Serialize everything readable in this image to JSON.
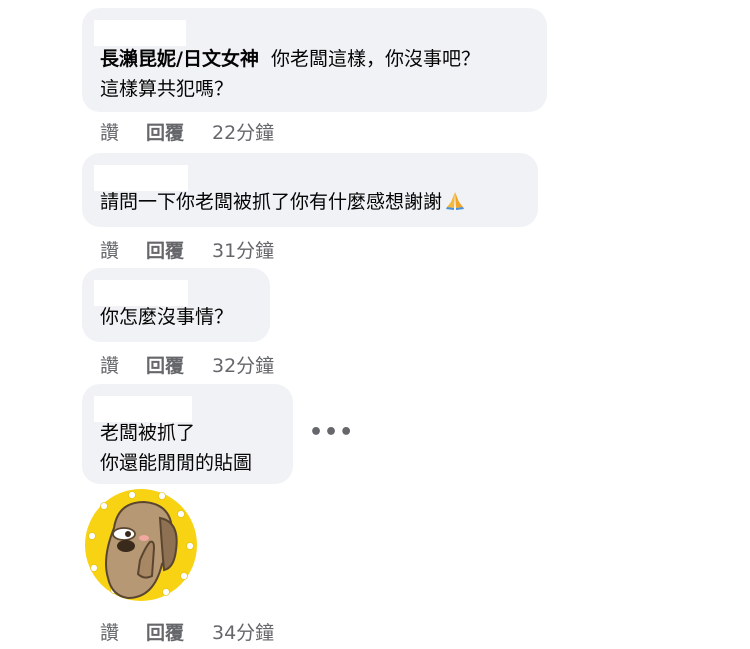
{
  "comments": [
    {
      "author": "長瀨昆妮/日文女神",
      "text_line1": "你老闆這樣，你沒事吧？",
      "text_line2": "這樣算共犯嗎？",
      "actions": {
        "like": "讚",
        "reply": "回覆",
        "time": "22分鐘"
      }
    },
    {
      "text": "請問一下你老闆被抓了你有什麼感想謝謝",
      "emoji": "folded-hands-icon",
      "actions": {
        "like": "讚",
        "reply": "回覆",
        "time": "31分鐘"
      }
    },
    {
      "text": "你怎麼沒事情？",
      "actions": {
        "like": "讚",
        "reply": "回覆",
        "time": "32分鐘"
      }
    },
    {
      "text_line1": "老闆被抓了",
      "text_line2": "你還能閒閒的貼圖",
      "menu": "•••",
      "sticker": "dog-face-palm-sticker",
      "actions": {
        "like": "讚",
        "reply": "回覆",
        "time": "34分鐘"
      }
    }
  ],
  "colors": {
    "bubble": "#f0f2f5",
    "meta": "#65676b",
    "sticker_bg": "#f7d313"
  }
}
